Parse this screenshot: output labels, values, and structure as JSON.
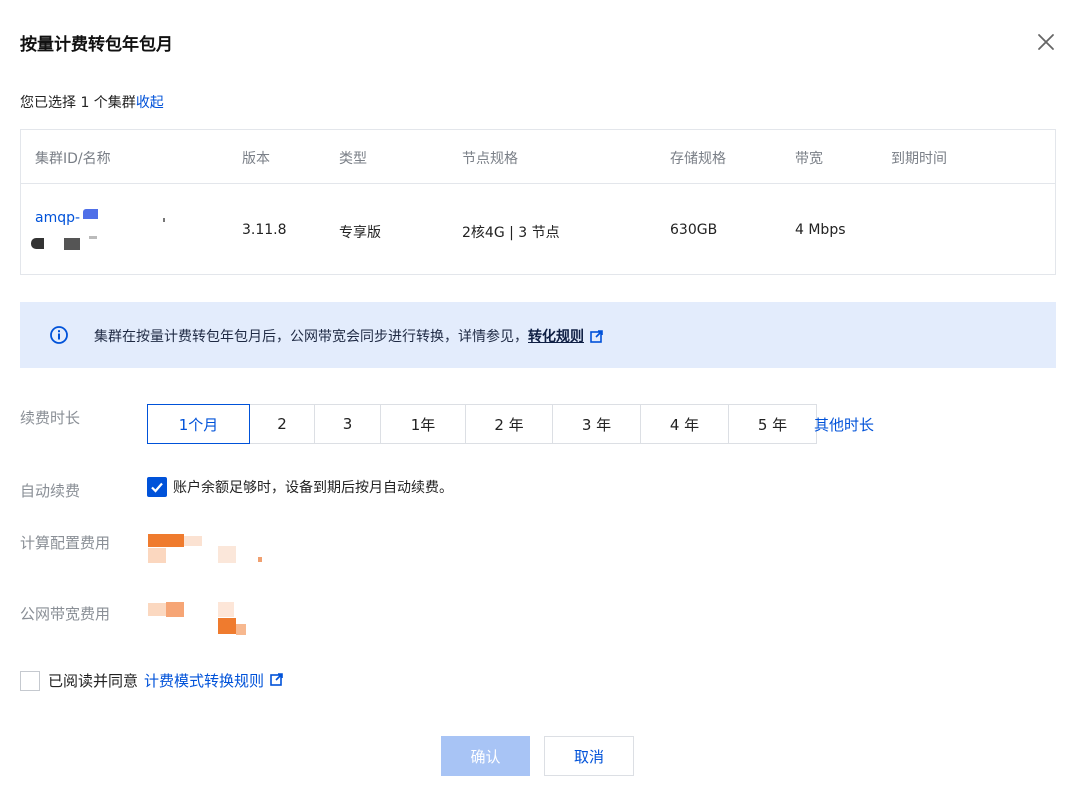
{
  "dialog": {
    "title": "按量计费转包年包月"
  },
  "selection": {
    "text": "您已选择 1 个集群",
    "toggle_label": "收起"
  },
  "table": {
    "headers": [
      "集群ID/名称",
      "版本",
      "类型",
      "节点规格",
      "存储规格",
      "带宽",
      "到期时间"
    ],
    "row": {
      "cluster_name": "amqp-",
      "version": "3.11.8",
      "type": "专享版",
      "node_spec": "2核4G | 3 节点",
      "storage": "630GB",
      "bandwidth": "4 Mbps",
      "expire": ""
    }
  },
  "notice": {
    "text": "集群在按量计费转包年包月后，公网带宽会同步进行转换，详情参见，",
    "link_label": "转化规则",
    "icon": "info-circle-icon"
  },
  "renewal": {
    "label": "续费时长",
    "options": [
      "1个月",
      "2",
      "3",
      "1年",
      "2 年",
      "3 年",
      "4 年",
      "5 年"
    ],
    "selected_index": 0,
    "other_label": "其他时长"
  },
  "auto_renew": {
    "label": "自动续费",
    "checked": true,
    "text": "账户余额足够时，设备到期后按月自动续费。"
  },
  "fees": {
    "compute_label": "计算配置费用",
    "bandwidth_label": "公网带宽费用"
  },
  "agreement": {
    "checked": false,
    "text": "已阅读并同意",
    "link_label": "计费模式转换规则"
  },
  "buttons": {
    "confirm": "确认",
    "cancel": "取消"
  },
  "colors": {
    "primary": "#0052d9",
    "notice_bg": "#e3ecfc",
    "price": "#ef7b2e",
    "disabled_primary": "#a8c4f5"
  }
}
